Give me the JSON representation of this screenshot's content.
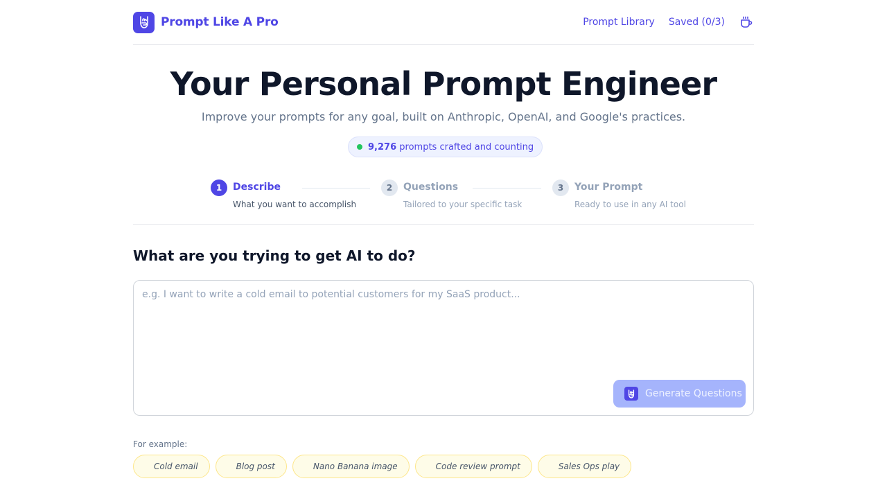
{
  "header": {
    "brand": "Prompt Like A Pro",
    "nav": {
      "library": "Prompt Library",
      "saved": "Saved (0/3)"
    },
    "icons": {
      "logo": "rock-hand-icon",
      "support": "coffee-cup-icon"
    }
  },
  "hero": {
    "title": "Your Personal Prompt Engineer",
    "subtitle": "Improve your prompts for any goal, built on Anthropic, OpenAI, and Google's practices.",
    "counter_number": "9,276",
    "counter_text": "prompts crafted and counting"
  },
  "steps": [
    {
      "num": "1",
      "title": "Describe",
      "desc": "What you want to accomplish",
      "state": "active"
    },
    {
      "num": "2",
      "title": "Questions",
      "desc": "Tailored to your specific task",
      "state": "idle"
    },
    {
      "num": "3",
      "title": "Your Prompt",
      "desc": "Ready to use in any AI tool",
      "state": "idle"
    }
  ],
  "main": {
    "question": "What are you trying to get AI to do?",
    "placeholder": "e.g. I want to write a cold email to potential customers for my SaaS product...",
    "value": "",
    "button": "Generate Questions"
  },
  "examples": {
    "label": "For example:",
    "chips": [
      "Cold email",
      "Blog post",
      "Nano Banana image",
      "Code review prompt",
      "Sales Ops play"
    ]
  },
  "colors": {
    "accent": "#4f46e5",
    "button_disabled": "#a5b4fc",
    "status_dot": "#22c55e",
    "chip_bg": "#fefce8",
    "chip_border": "#fde68a"
  }
}
